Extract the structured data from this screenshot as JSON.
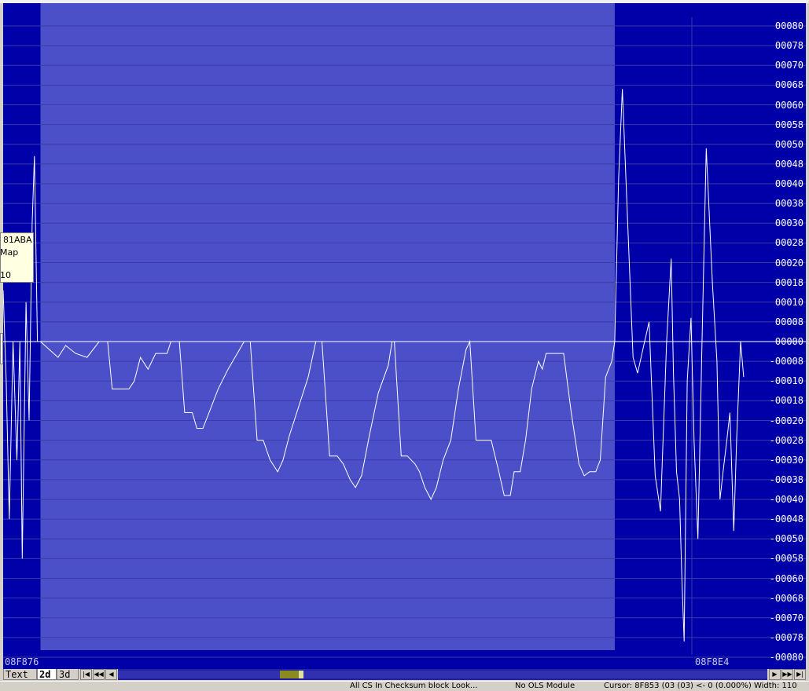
{
  "colors": {
    "background": "#0000a8",
    "selection": "#4b50c8",
    "grid": "#3a3aa8",
    "line": "#ffffff",
    "axis_text": "#ffffff"
  },
  "address_left": "08F876",
  "address_right": "08F8E4",
  "tooltip": {
    "line1": "81ABA",
    "line2": "Map",
    "line3": "10"
  },
  "tabs": [
    {
      "label": "Text",
      "active": false
    },
    {
      "label": "2d",
      "active": true
    },
    {
      "label": "3d",
      "active": false
    }
  ],
  "nav_icons": [
    "first-icon",
    "prev-page-icon",
    "prev-icon",
    "next-icon",
    "next-page-icon",
    "last-icon"
  ],
  "status": {
    "segment1": "All CS    In Checksum block  Look...",
    "segment2": "No OLS Module",
    "segment3": "Cursor: 8F853 (03 (03) <- 0 (0.000%)  Width: 110"
  },
  "chart_data": {
    "type": "line",
    "title": "",
    "xlabel": "",
    "ylabel": "",
    "y_tick_labels": [
      "00080",
      "00078",
      "00070",
      "00068",
      "00060",
      "00058",
      "00050",
      "00048",
      "00040",
      "00038",
      "00030",
      "00028",
      "00020",
      "00018",
      "00010",
      "00008",
      "00000",
      "-00008",
      "-00010",
      "-00018",
      "-00020",
      "-00028",
      "-00030",
      "-00038",
      "-00040",
      "-00048",
      "-00050",
      "-00058",
      "-00060",
      "-00068",
      "-00070",
      "-00078",
      "-00080"
    ],
    "ylim": [
      -80,
      80
    ],
    "x_range": [
      0,
      1
    ],
    "selection_range": [
      0.049,
      0.802
    ],
    "grid": true,
    "series": [
      {
        "points": [
          [
            0.0,
            13
          ],
          [
            0.004,
            -10
          ],
          [
            0.008,
            -45
          ],
          [
            0.013,
            0
          ],
          [
            0.018,
            -30
          ],
          [
            0.022,
            0
          ],
          [
            0.025,
            -55
          ],
          [
            0.03,
            10
          ],
          [
            0.034,
            -20
          ],
          [
            0.038,
            30
          ],
          [
            0.041,
            47
          ],
          [
            0.045,
            0
          ],
          [
            0.049,
            0
          ],
          [
            0.072,
            -4
          ],
          [
            0.082,
            -1
          ],
          [
            0.095,
            -3
          ],
          [
            0.11,
            -4
          ],
          [
            0.126,
            0
          ],
          [
            0.137,
            0
          ],
          [
            0.143,
            -12
          ],
          [
            0.165,
            -12
          ],
          [
            0.172,
            -10
          ],
          [
            0.18,
            -4
          ],
          [
            0.19,
            -7
          ],
          [
            0.2,
            -3
          ],
          [
            0.215,
            -3
          ],
          [
            0.22,
            0
          ],
          [
            0.231,
            0
          ],
          [
            0.238,
            -18
          ],
          [
            0.248,
            -18
          ],
          [
            0.254,
            -22
          ],
          [
            0.262,
            -22
          ],
          [
            0.27,
            -18
          ],
          [
            0.282,
            -12
          ],
          [
            0.295,
            -7
          ],
          [
            0.307,
            -3
          ],
          [
            0.316,
            0
          ],
          [
            0.324,
            0
          ],
          [
            0.333,
            -25
          ],
          [
            0.341,
            -25
          ],
          [
            0.35,
            -30
          ],
          [
            0.36,
            -33
          ],
          [
            0.367,
            -30
          ],
          [
            0.375,
            -24
          ],
          [
            0.39,
            -15
          ],
          [
            0.4,
            -9
          ],
          [
            0.41,
            0
          ],
          [
            0.418,
            0
          ],
          [
            0.428,
            -29
          ],
          [
            0.438,
            -29
          ],
          [
            0.446,
            -31
          ],
          [
            0.455,
            -35
          ],
          [
            0.462,
            -37
          ],
          [
            0.47,
            -34
          ],
          [
            0.48,
            -24
          ],
          [
            0.492,
            -13
          ],
          [
            0.505,
            -6
          ],
          [
            0.51,
            0
          ],
          [
            0.513,
            0
          ],
          [
            0.522,
            -29
          ],
          [
            0.53,
            -29
          ],
          [
            0.54,
            -31
          ],
          [
            0.546,
            -33
          ],
          [
            0.553,
            -37
          ],
          [
            0.561,
            -40
          ],
          [
            0.568,
            -37
          ],
          [
            0.577,
            -30
          ],
          [
            0.587,
            -25
          ],
          [
            0.597,
            -12
          ],
          [
            0.607,
            -2
          ],
          [
            0.612,
            0
          ],
          [
            0.62,
            -25
          ],
          [
            0.64,
            -25
          ],
          [
            0.65,
            -33
          ],
          [
            0.657,
            -39
          ],
          [
            0.665,
            -39
          ],
          [
            0.67,
            -33
          ],
          [
            0.678,
            -33
          ],
          [
            0.685,
            -25
          ],
          [
            0.693,
            -12
          ],
          [
            0.702,
            -5
          ],
          [
            0.707,
            -7
          ],
          [
            0.712,
            -3
          ],
          [
            0.72,
            -3
          ],
          [
            0.735,
            -3
          ],
          [
            0.745,
            -18
          ],
          [
            0.755,
            -31
          ],
          [
            0.762,
            -34
          ],
          [
            0.769,
            -33
          ],
          [
            0.777,
            -33
          ],
          [
            0.783,
            -30
          ],
          [
            0.79,
            -9
          ],
          [
            0.798,
            -5
          ],
          [
            0.802,
            0
          ],
          [
            0.807,
            41
          ],
          [
            0.812,
            64
          ],
          [
            0.819,
            30
          ],
          [
            0.826,
            -4
          ],
          [
            0.832,
            -8
          ],
          [
            0.84,
            -1
          ],
          [
            0.847,
            5
          ],
          [
            0.855,
            -34
          ],
          [
            0.862,
            -43
          ],
          [
            0.87,
            0
          ],
          [
            0.876,
            21
          ],
          [
            0.879,
            -8
          ],
          [
            0.883,
            -33
          ],
          [
            0.887,
            -40
          ],
          [
            0.89,
            -60
          ],
          [
            0.893,
            -76
          ],
          [
            0.897,
            -10
          ],
          [
            0.902,
            6
          ],
          [
            0.906,
            -25
          ],
          [
            0.911,
            -50
          ],
          [
            0.916,
            -4
          ],
          [
            0.922,
            49
          ],
          [
            0.93,
            15
          ],
          [
            0.936,
            -5
          ],
          [
            0.94,
            -40
          ],
          [
            0.944,
            -33
          ],
          [
            0.949,
            -25
          ],
          [
            0.953,
            -18
          ],
          [
            0.958,
            -48
          ],
          [
            0.962,
            -24
          ],
          [
            0.967,
            0
          ],
          [
            0.971,
            -9
          ]
        ]
      }
    ]
  }
}
